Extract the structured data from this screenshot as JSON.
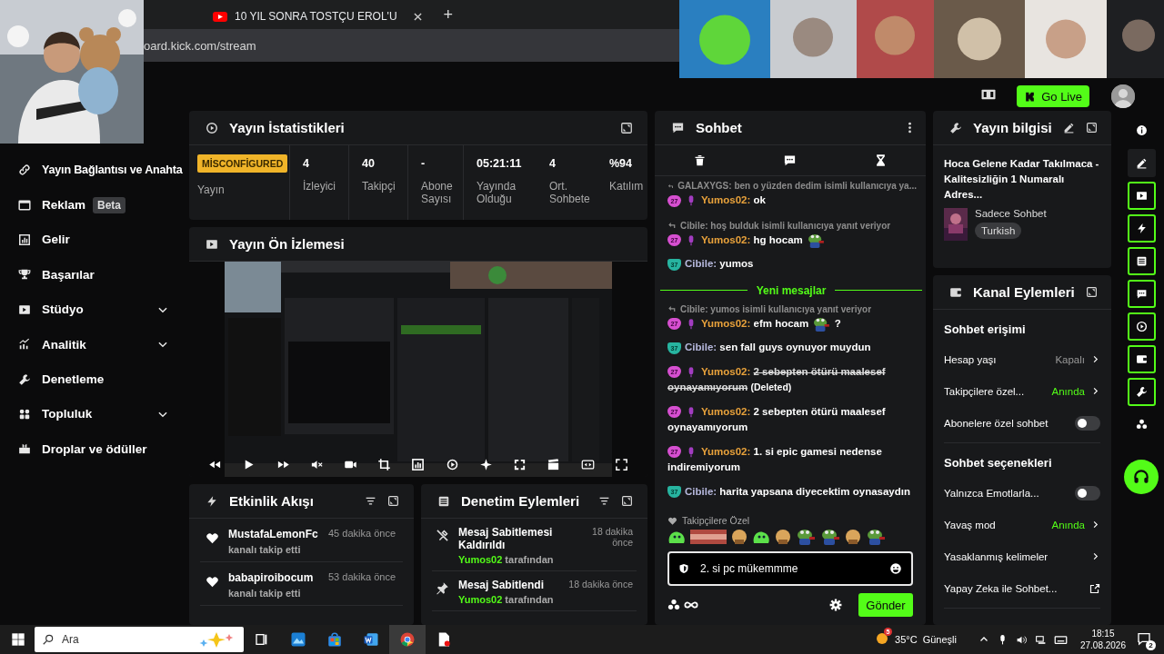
{
  "browser": {
    "tabs": [
      {
        "title": "10 YIL SONRA TOSTÇU EROL'U",
        "selected": false
      }
    ],
    "new_tab": "+",
    "address": "oard.kick.com/stream"
  },
  "header": {
    "go_live": "Go Live"
  },
  "sidebar": {
    "items": [
      {
        "label": "Yayın Bağlantısı ve Anahta"
      },
      {
        "label": "Reklam",
        "badge": "Beta"
      },
      {
        "label": "Gelir"
      },
      {
        "label": "Başarılar"
      },
      {
        "label": "Stüdyo",
        "expanded": false
      },
      {
        "label": "Analitik",
        "expanded": false
      },
      {
        "label": "Denetleme"
      },
      {
        "label": "Topluluk",
        "expanded": false
      },
      {
        "label": "Droplar ve ödüller"
      }
    ]
  },
  "stats": {
    "title": "Yayın İstatistikleri",
    "status": "MİSCONFİGURED",
    "status_label": "Yayın",
    "items": [
      {
        "value": "4",
        "label": "İzleyici"
      },
      {
        "value": "40",
        "label": "Takipçi"
      },
      {
        "value": "-",
        "label": "Abone Sayısı"
      },
      {
        "value": "05:21:11",
        "label": "Yayında Olduğu"
      },
      {
        "value": "4",
        "label": "Ort. Sohbete"
      },
      {
        "value": "%94",
        "label": "Katılım"
      }
    ]
  },
  "preview": {
    "title": "Yayın Ön İzlemesi"
  },
  "activity": {
    "title": "Etkinlik Akışı",
    "events": [
      {
        "user": "MustafaLemonFc",
        "action": "kanalı takip etti",
        "time": "45 dakika önce"
      },
      {
        "user": "babapiroibocum",
        "action": "kanalı takip etti",
        "time": "53 dakika önce"
      }
    ]
  },
  "moderation": {
    "title": "Denetim Eylemleri",
    "actions": [
      {
        "kind": "unpin",
        "title": "Mesaj Sabitlemesi Kaldırıldı",
        "user": "Yumos02",
        "by": "tarafından",
        "time": "18 dakika önce"
      },
      {
        "kind": "pin",
        "title": "Mesaj Sabitlendi",
        "user": "Yumos02",
        "by": "tarafından",
        "time": "18 dakika önce"
      }
    ]
  },
  "chat": {
    "title": "Sohbet",
    "messages": [
      {
        "kind": "reply",
        "text": "GALAXYGS: ben o yüzden dedim isimli kullanıcıya ya..."
      },
      {
        "kind": "message",
        "user": "Yumos02:",
        "color": "#e9a23b",
        "badge": "27",
        "mic": true,
        "text": "ok"
      },
      {
        "kind": "reply",
        "text": "Cibile: hoş bulduk isimli kullanıcıya yanıt veriyor"
      },
      {
        "kind": "message",
        "user": "Yumos02:",
        "color": "#e9a23b",
        "badge": "27",
        "mic": true,
        "text": "hg hocam",
        "emote": true
      },
      {
        "kind": "message",
        "user": "Cibile:",
        "color": "#b7b9de",
        "badge": "37",
        "mic": false,
        "text": "yumos"
      },
      {
        "kind": "divider",
        "text": "Yeni mesajlar"
      },
      {
        "kind": "reply",
        "text": "Cibile: yumos isimli kullanıcıya yanıt veriyor"
      },
      {
        "kind": "message",
        "user": "Yumos02:",
        "color": "#e9a23b",
        "badge": "27",
        "mic": true,
        "text": "efm hocam",
        "emote": true,
        "after": "?"
      },
      {
        "kind": "message",
        "user": "Cibile:",
        "color": "#b7b9de",
        "badge": "37",
        "mic": false,
        "text": "sen fall guys oynuyor muydun"
      },
      {
        "kind": "message",
        "user": "Yumos02:",
        "color": "#e9a23b",
        "badge": "27",
        "mic": true,
        "text": "2 sebepten ötürü maalesef oynayamıyorum",
        "deleted": true,
        "note": "(Deleted)"
      },
      {
        "kind": "message",
        "user": "Yumos02:",
        "color": "#e9a23b",
        "badge": "27",
        "mic": true,
        "text": "2 sebepten ötürü maalesef oynayamıyorum"
      },
      {
        "kind": "message",
        "user": "Yumos02:",
        "color": "#e9a23b",
        "badge": "27",
        "mic": true,
        "text": "1. si epic gamesi nedense indiremiyorum"
      },
      {
        "kind": "message",
        "user": "Cibile:",
        "color": "#b7b9de",
        "badge": "37",
        "mic": false,
        "text": "harita yapsana diyecektim oynasaydın"
      }
    ],
    "emote_label": "Takipçilere Özel",
    "emotes": [
      {
        "kind": "blob"
      },
      {
        "kind": "strip"
      },
      {
        "kind": "face"
      },
      {
        "kind": "blob"
      },
      {
        "kind": "face"
      },
      {
        "kind": "frog"
      },
      {
        "kind": "frog"
      },
      {
        "kind": "face"
      },
      {
        "kind": "frog"
      }
    ],
    "input": "2. si pc mükemmme",
    "send": "Gönder"
  },
  "info": {
    "title": "Yayın bilgisi",
    "stream_title": "Hoca Gelene Kadar Takılmaca - Kalitesizliğin 1 Numaralı Adres...",
    "category": "Sadece Sohbet",
    "tag": "Turkish"
  },
  "actions": {
    "title": "Kanal Eylemleri",
    "sections": [
      {
        "title": "Sohbet erişimi",
        "rows": [
          {
            "kind": "value",
            "label": "Hesap yaşı",
            "value": "Kapalı",
            "active": false
          },
          {
            "kind": "value",
            "label": "Takipçilere özel...",
            "value": "Anında",
            "active": true
          },
          {
            "kind": "toggle",
            "label": "Abonelere özel sohbet",
            "on": false
          }
        ]
      },
      {
        "title": "Sohbet seçenekleri",
        "rows": [
          {
            "kind": "toggle",
            "label": "Yalnızca Emotlarla...",
            "on": false
          },
          {
            "kind": "value",
            "label": "Yavaş mod",
            "value": "Anında",
            "active": true
          },
          {
            "kind": "link",
            "label": "Yasaklanmış kelimeler"
          },
          {
            "kind": "external",
            "label": "Yapay Zeka ile Sohbet..."
          }
        ]
      }
    ]
  },
  "rail": [
    {
      "active": false
    },
    {
      "active": false
    },
    {
      "active": true
    },
    {
      "active": true
    },
    {
      "active": true
    },
    {
      "active": true
    },
    {
      "active": true
    },
    {
      "active": true
    },
    {
      "active": true
    },
    {
      "active": false
    }
  ],
  "taskbar": {
    "search": "Ara",
    "weather_badge": "5",
    "temperature": "35°C",
    "weather": "Güneşli",
    "time": "18:15",
    "date": "27.08.2026",
    "notifications": "2"
  }
}
